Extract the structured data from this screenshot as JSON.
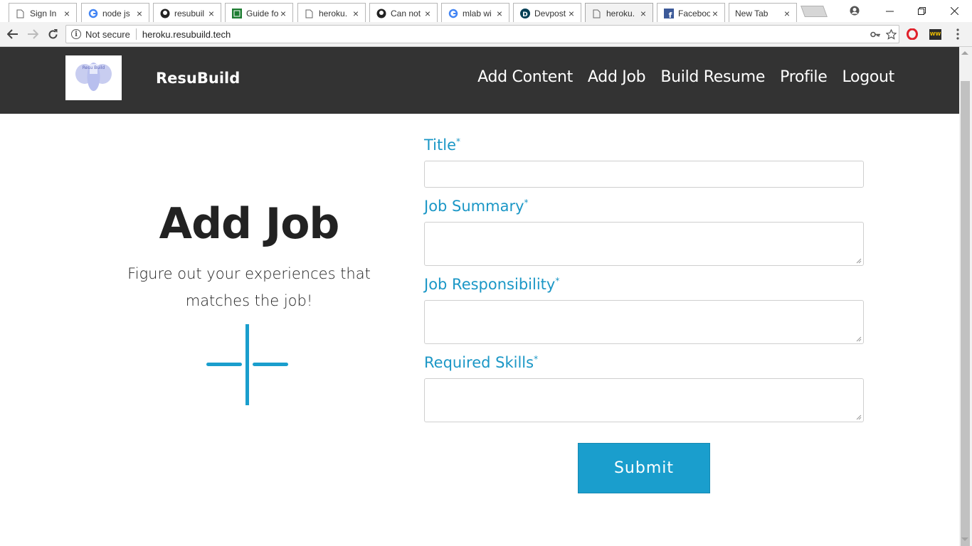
{
  "browser": {
    "tabs": [
      {
        "title": "Sign In",
        "icon": "document-icon"
      },
      {
        "title": "node js",
        "icon": "google-icon"
      },
      {
        "title": "resubuil",
        "icon": "github-icon"
      },
      {
        "title": "Guide fo",
        "icon": "green-guide-icon"
      },
      {
        "title": "heroku.",
        "icon": "document-icon"
      },
      {
        "title": "Can not",
        "icon": "github-icon"
      },
      {
        "title": "mlab wi",
        "icon": "google-icon"
      },
      {
        "title": "Devpost",
        "icon": "devpost-icon"
      },
      {
        "title": "heroku.",
        "icon": "document-icon",
        "active": true
      },
      {
        "title": "Faceboo",
        "icon": "facebook-icon"
      },
      {
        "title": "New Tab",
        "icon": ""
      }
    ],
    "security_label": "Not secure",
    "url": "heroku.resubuild.tech",
    "ext_badge": "WW"
  },
  "site": {
    "brand": "ResuBuild",
    "logo_text": "Resu Build",
    "nav": [
      "Add Content",
      "Add Job",
      "Build Resume",
      "Profile",
      "Logout"
    ]
  },
  "hero": {
    "title": "Add Job",
    "subtitle": "Figure out your experiences that matches the job!"
  },
  "form": {
    "title_label": "Title",
    "summary_label": "Job Summary",
    "responsibility_label": "Job Responsibility",
    "skills_label": "Required Skills",
    "required_mark": "*",
    "submit_label": "Submit"
  },
  "colors": {
    "navbar": "#333333",
    "accent": "#1a9ecd",
    "label": "#1b97c6"
  }
}
